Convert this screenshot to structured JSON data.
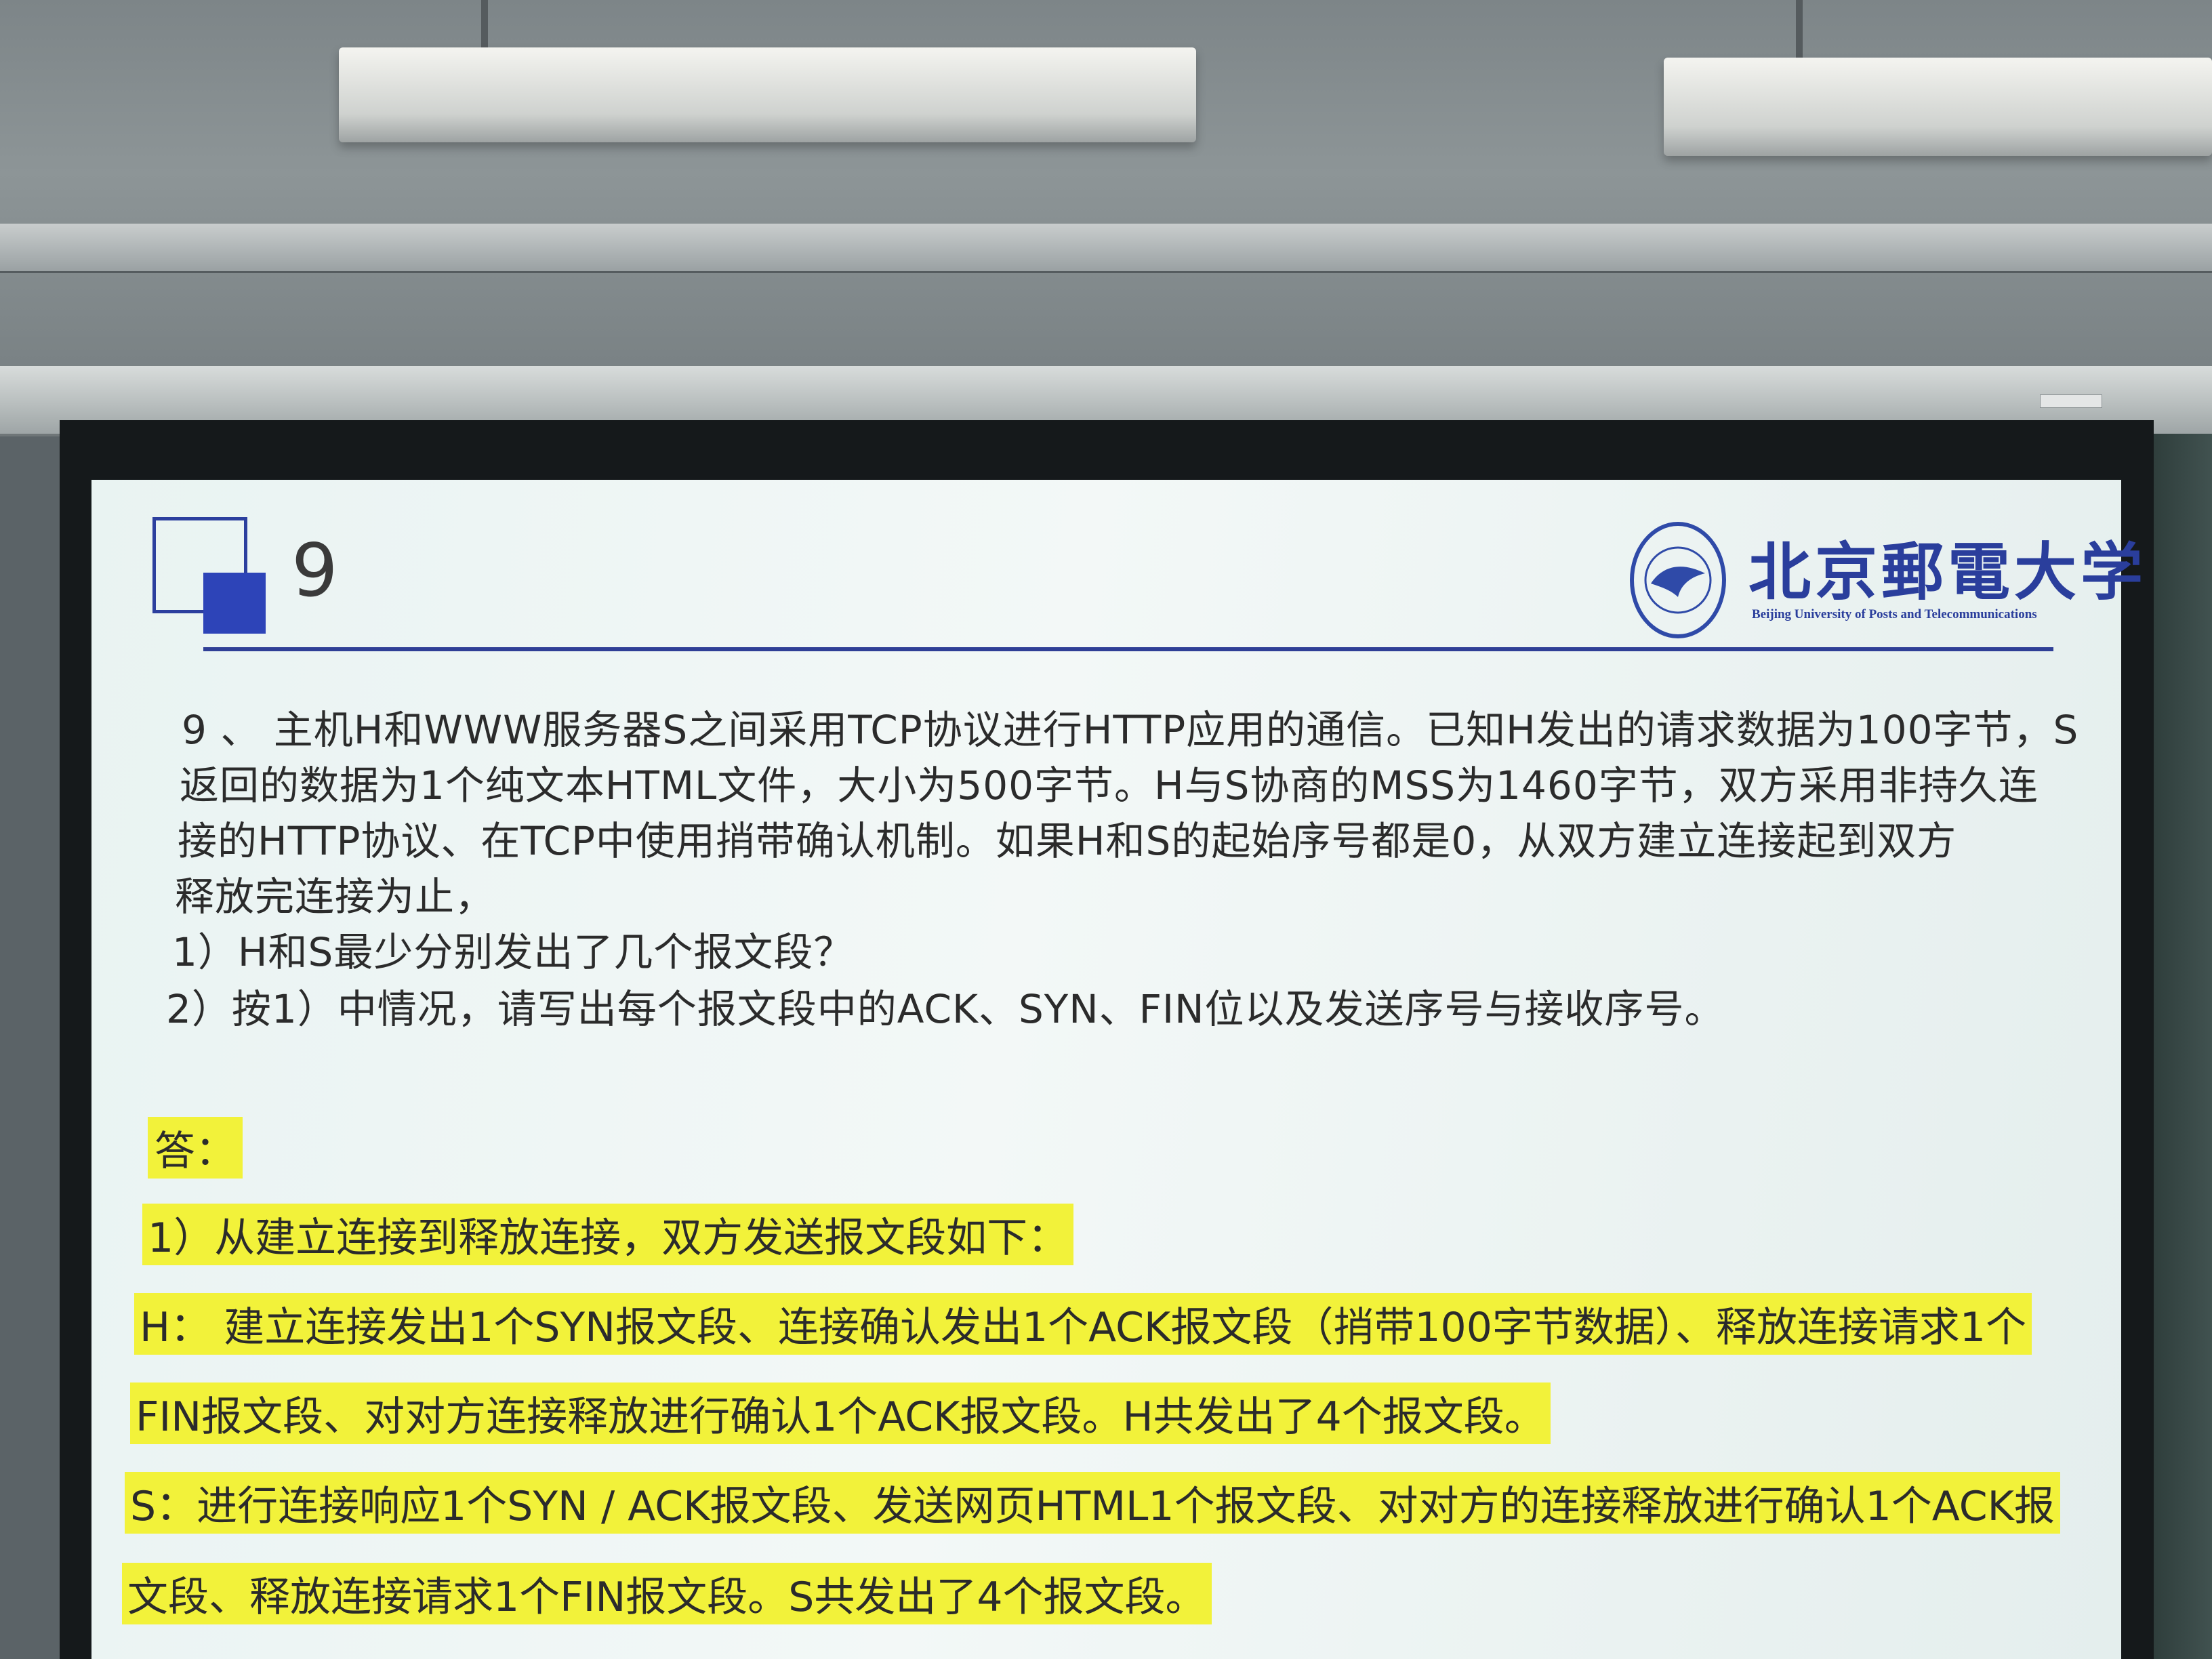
{
  "slide": {
    "number": "9",
    "university": {
      "name_cn": "北京郵電大学",
      "name_en": "Beijing University of Posts and Telecommunications"
    },
    "question": [
      "9 、 主机H和WWW服务器S之间采用TCP协议进行HTTP应用的通信。已知H发出的请求数据为100字节，S",
      "返回的数据为1个纯文本HTML文件，大小为500字节。H与S协商的MSS为1460字节，双方采用非持久连",
      "接的HTTP协议、在TCP中使用捎带确认机制。如果H和S的起始序号都是0，从双方建立连接起到双方",
      "释放完连接为止，",
      "1）H和S最少分别发出了几个报文段？",
      "2）按1）中情况，请写出每个报文段中的ACK、SYN、FIN位以及发送序号与接收序号。"
    ],
    "answer_label": "答：",
    "answer": [
      "1）从建立连接到释放连接，双方发送报文段如下：",
      "H： 建立连接发出1个SYN报文段、连接确认发出1个ACK报文段（捎带100字节数据）、释放连接请求1个",
      "FIN报文段、对对方连接释放进行确认1个ACK报文段。H共发出了4个报文段。",
      "S：进行连接响应1个SYN / ACK报文段、发送网页HTML1个报文段、对对方的连接释放进行确认1个ACK报",
      "文段、释放连接请求1个FIN报文段。S共发出了4个报文段。"
    ]
  },
  "colors": {
    "highlight": "#f2f23a",
    "brand_blue": "#2c3f9e",
    "text": "#2b2b2b"
  }
}
